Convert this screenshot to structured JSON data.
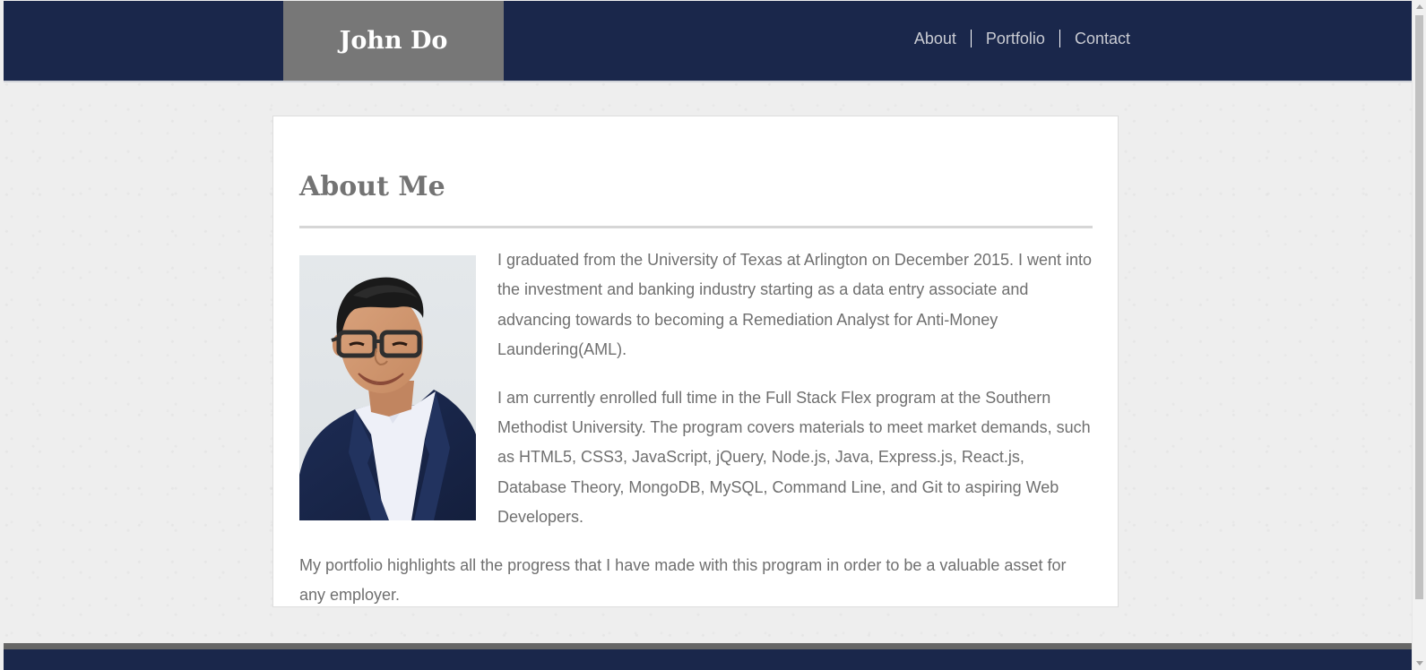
{
  "header": {
    "brand": "John Do",
    "nav": [
      {
        "label": "About"
      },
      {
        "label": "Portfolio"
      },
      {
        "label": "Contact"
      }
    ]
  },
  "about": {
    "title": "About Me",
    "photo_icon": "profile-photo",
    "paragraphs": [
      "I graduated from the University of Texas at Arlington on December 2015. I went into the investment and banking industry starting as a data entry associate and advancing towards to becoming a Remediation Analyst for Anti-Money Laundering(AML).",
      "I am currently enrolled full time in the Full Stack Flex program at the Southern Methodist University. The program covers materials to meet market demands, such as HTML5, CSS3, JavaScript, jQuery, Node.js, Java, Express.js, React.js, Database Theory, MongoDB, MySQL, Command Line, and Git to aspiring Web Developers.",
      "My portfolio highlights all the progress that I have made with this program in order to be a valuable asset for any employer."
    ]
  },
  "colors": {
    "header_bg": "#1a274b",
    "brand_bg": "#777777",
    "nav_text": "#c9cbd2",
    "body_text": "#6f6f6f",
    "footer_accent": "#666666"
  }
}
